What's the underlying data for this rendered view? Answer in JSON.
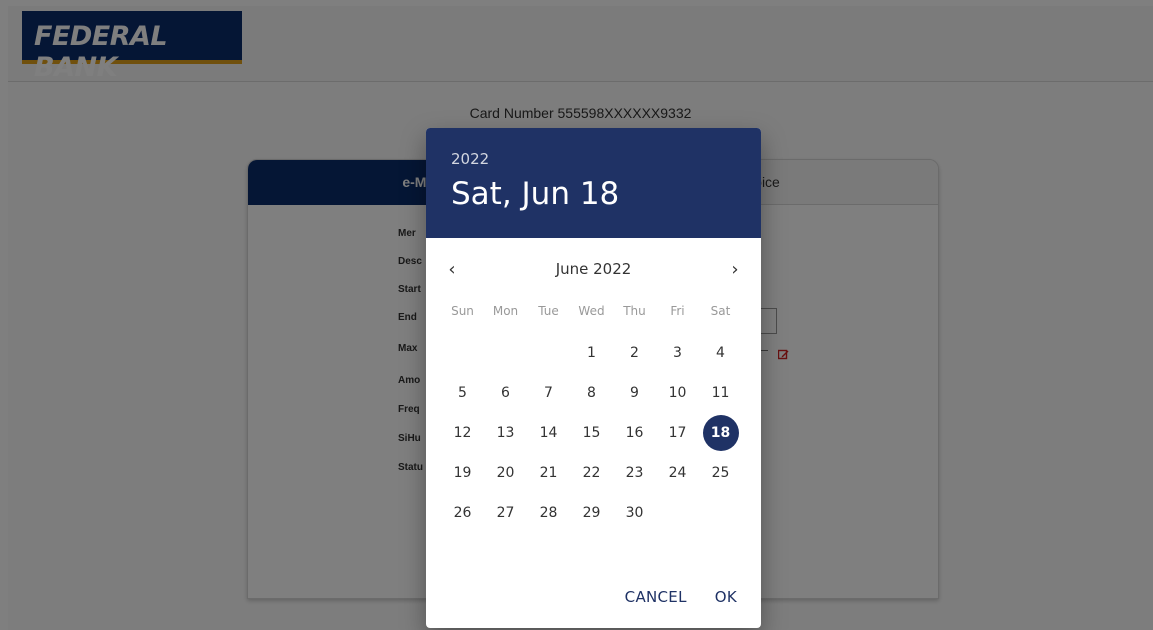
{
  "bank": {
    "logo_text": "FEDERAL BANK"
  },
  "card": {
    "number": "Card Number 555598XXXXXX9332"
  },
  "tabs": {
    "left": "e-Mar",
    "right": "oice"
  },
  "fields": [
    "Mer",
    "Desc",
    "Start",
    "End",
    "Max",
    "Amo",
    "Freq",
    "SiHu",
    "Statu"
  ],
  "picker": {
    "year": "2022",
    "selected_label": "Sat, Jun 18",
    "month_label": "June 2022",
    "weekdays": [
      "Sun",
      "Mon",
      "Tue",
      "Wed",
      "Thu",
      "Fri",
      "Sat"
    ],
    "leading_blanks": 3,
    "days_in_month": 30,
    "selected_day": 18,
    "cancel_label": "CANCEL",
    "ok_label": "OK",
    "prev_symbol": "‹",
    "next_symbol": "›"
  },
  "colors": {
    "primary": "#1f3265",
    "bank_blue": "#0b2c6b",
    "bank_accent": "#e0a01a",
    "edit_icon": "#d32020"
  }
}
